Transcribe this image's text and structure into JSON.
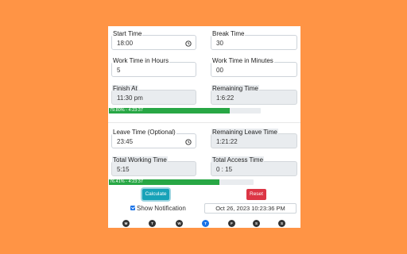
{
  "form": {
    "start_time": {
      "label": "Start Time",
      "value": "18:00"
    },
    "break_time": {
      "label": "Break Time",
      "value": "30"
    },
    "work_hours": {
      "label": "Work Time in Hours",
      "value": "5"
    },
    "work_minutes": {
      "label": "Work Time in Minutes",
      "value": "00"
    },
    "finish_at": {
      "label": "Finish At",
      "value": "11:30 pm"
    },
    "remaining_time": {
      "label": "Remaining Time",
      "value": "1:6:22"
    },
    "leave_time": {
      "label": "Leave Time (Optional)",
      "value": "23:45"
    },
    "remaining_leave": {
      "label": "Remaining Leave Time",
      "value": "1:21:22"
    },
    "total_working": {
      "label": "Total Working Time",
      "value": "5:15"
    },
    "total_access": {
      "label": "Total Access Time",
      "value": "0 : 15"
    }
  },
  "progress_1": {
    "percent": 79.8,
    "label": "79.80% - 4:23:37"
  },
  "progress_2": {
    "percent": 76.41,
    "label": "76.41% - 4:23:37"
  },
  "actions": {
    "calculate_label": "Calculate",
    "reset_label": "Reset"
  },
  "notification": {
    "label": "Show Notification",
    "checked": true
  },
  "datetime": "Oct 26, 2023 10:23:36 PM",
  "weekdays": [
    {
      "letter": "M",
      "active": false
    },
    {
      "letter": "T",
      "active": false
    },
    {
      "letter": "W",
      "active": false
    },
    {
      "letter": "T",
      "active": true
    },
    {
      "letter": "F",
      "active": false
    },
    {
      "letter": "S",
      "active": false
    },
    {
      "letter": "S",
      "active": false
    }
  ],
  "colors": {
    "background": "#ff9445",
    "progress": "#28a745",
    "calculate": "#17a2b8",
    "reset": "#dc3545",
    "active_day": "#1a73e8",
    "inactive_day": "#333333"
  }
}
